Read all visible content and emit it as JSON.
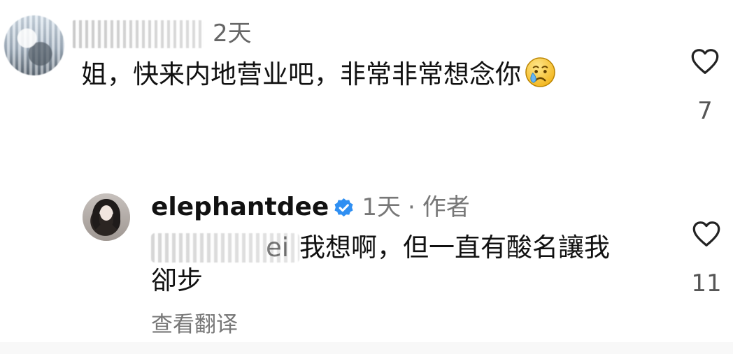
{
  "comment_thread": {
    "top_comment": {
      "relative_time": "2天",
      "text": "姐，快来内地营业吧，非常非常想念你",
      "emoji_icon": "crying-face",
      "likes": "7"
    },
    "reply": {
      "username": "elephantdee",
      "relative_time": "1天",
      "meta_separator": "·",
      "author_label": "作者",
      "mention_suffix": "ei",
      "text_line1": "我想啊，但一直有酸名讓我",
      "text_line2": "卻步",
      "likes": "11",
      "translate_link": "查看翻译"
    }
  }
}
